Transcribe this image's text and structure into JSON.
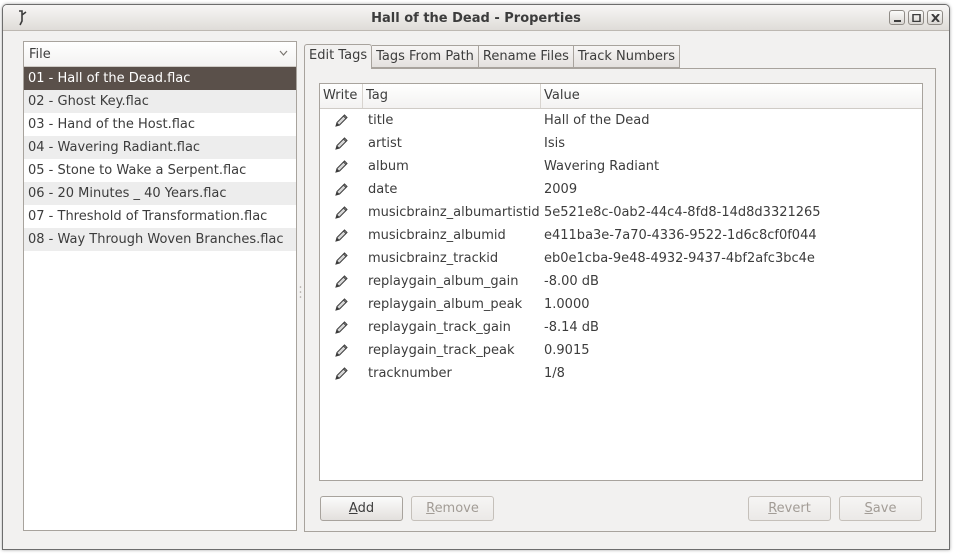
{
  "window": {
    "title": "Hall of the Dead - Properties"
  },
  "file_list": {
    "header": "File",
    "selected_index": 0,
    "items": [
      "01 - Hall of the Dead.flac",
      "02 - Ghost Key.flac",
      "03 - Hand of the Host.flac",
      "04 - Wavering Radiant.flac",
      "05 - Stone to Wake a Serpent.flac",
      "06 - 20 Minutes _ 40 Years.flac",
      "07 - Threshold of Transformation.flac",
      "08 - Way Through Woven Branches.flac"
    ]
  },
  "tabs": [
    "Edit Tags",
    "Tags From Path",
    "Rename Files",
    "Track Numbers"
  ],
  "active_tab": 0,
  "tag_table": {
    "columns": {
      "write": "Write",
      "tag": "Tag",
      "value": "Value"
    },
    "write_icon": "pencil-icon",
    "rows": [
      {
        "tag": "title",
        "value": "Hall of the Dead"
      },
      {
        "tag": "artist",
        "value": "Isis"
      },
      {
        "tag": "album",
        "value": "Wavering Radiant"
      },
      {
        "tag": "date",
        "value": "2009"
      },
      {
        "tag": "musicbrainz_albumartistid",
        "value": "5e521e8c-0ab2-44c4-8fd8-14d8d3321265"
      },
      {
        "tag": "musicbrainz_albumid",
        "value": "e411ba3e-7a70-4336-9522-1d6c8cf0f044"
      },
      {
        "tag": "musicbrainz_trackid",
        "value": "eb0e1cba-9e48-4932-9437-4bf2afc3bc4e"
      },
      {
        "tag": "replaygain_album_gain",
        "value": "-8.00 dB"
      },
      {
        "tag": "replaygain_album_peak",
        "value": "1.0000"
      },
      {
        "tag": "replaygain_track_gain",
        "value": "-8.14 dB"
      },
      {
        "tag": "replaygain_track_peak",
        "value": "0.9015"
      },
      {
        "tag": "tracknumber",
        "value": "1/8"
      }
    ]
  },
  "buttons": {
    "add": {
      "label": "Add",
      "mnemonic": "A",
      "rest": "dd"
    },
    "remove": {
      "label": "Remove",
      "mnemonic": "R",
      "rest": "emove"
    },
    "revert": {
      "label": "Revert",
      "mnemonic": "R",
      "rest": "evert"
    },
    "save": {
      "label": "Save",
      "mnemonic": "S",
      "rest": "ave"
    }
  },
  "colors": {
    "selection": "#5a504a",
    "row_alt": "#ededed",
    "window_bg": "#f2f1f0"
  }
}
